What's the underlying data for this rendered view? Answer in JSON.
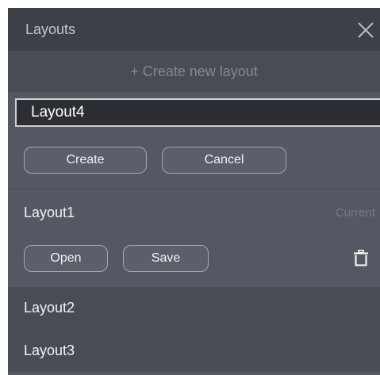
{
  "header": {
    "title": "Layouts",
    "close_icon": "close-icon"
  },
  "create_new": {
    "label": "+ Create new layout"
  },
  "new_layout_form": {
    "input_value": "Layout4",
    "create_label": "Create",
    "cancel_label": "Cancel"
  },
  "layouts": [
    {
      "name": "Layout1",
      "status": "Current",
      "open_label": "Open",
      "save_label": "Save",
      "delete_icon": "trash-icon"
    },
    {
      "name": "Layout2"
    },
    {
      "name": "Layout3"
    }
  ],
  "colors": {
    "panel": "#555862",
    "header": "#3e4047",
    "row": "#4a4c55",
    "input": "#2c2e34",
    "text": "#f2f3f5",
    "muted": "#848791"
  }
}
